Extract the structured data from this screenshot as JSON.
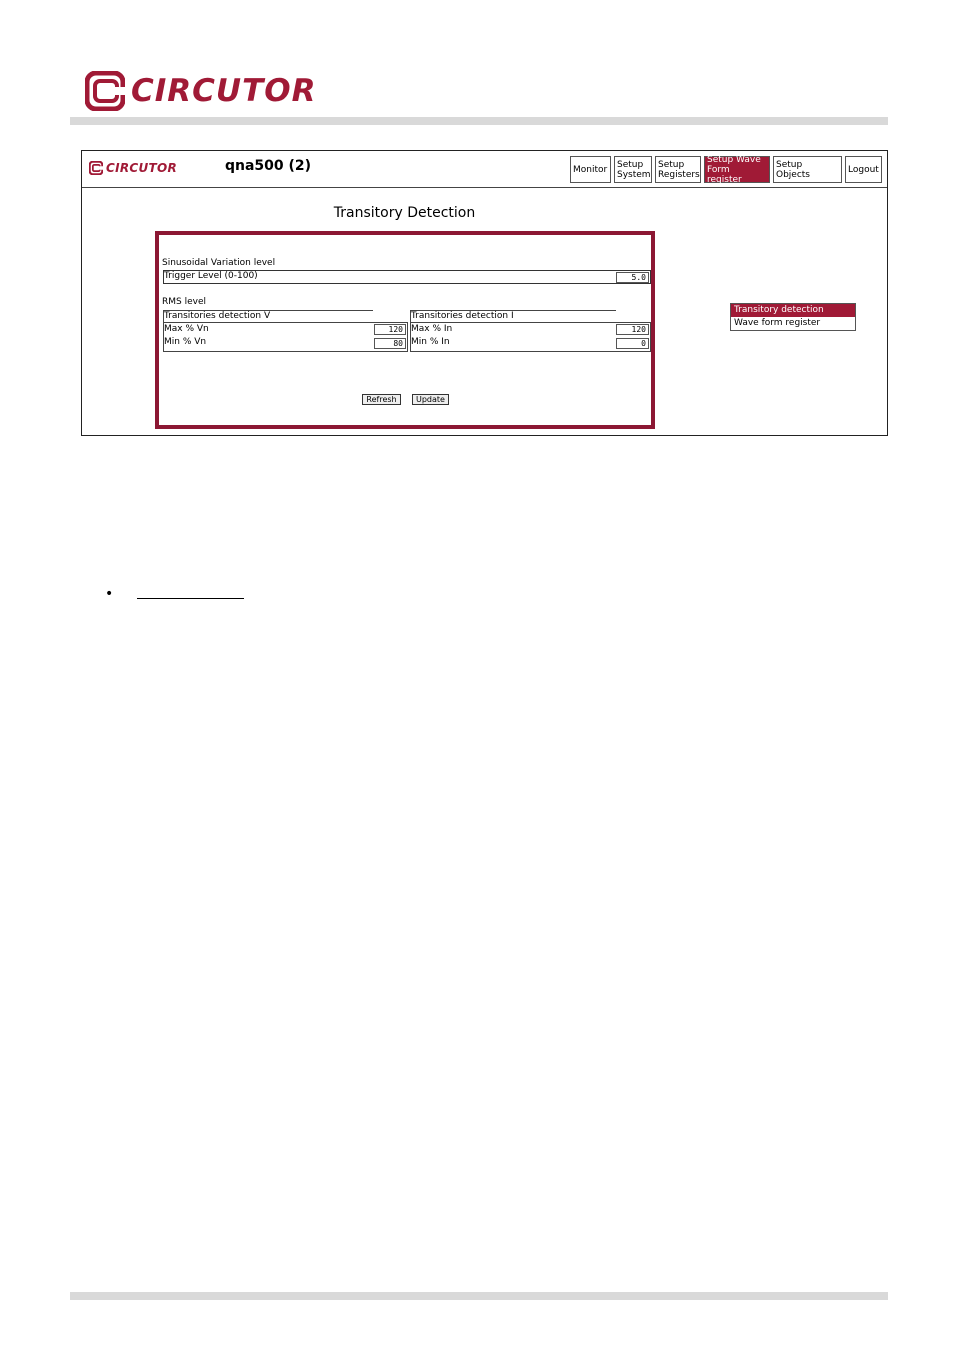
{
  "brand": {
    "name": "CIRCUTOR",
    "color": "#a01a36"
  },
  "device_title": "qna500 (2)",
  "nav": [
    {
      "label": "Monitor",
      "active": false
    },
    {
      "label": "Setup System",
      "active": false
    },
    {
      "label": "Setup Registers",
      "active": false
    },
    {
      "label": "Setup Wave Form register",
      "active": true
    },
    {
      "label": "Setup Objects",
      "active": false
    },
    {
      "label": "Logout",
      "active": false
    }
  ],
  "page_title": "Transitory Detection",
  "sinusoidal": {
    "heading": "Sinusoidal Variation level",
    "trigger_label": "Trigger Level (0-100)",
    "trigger_value": "5.0"
  },
  "rms": {
    "heading": "RMS level",
    "voltage": {
      "title": "Transitories detection V",
      "max_label": "Max % Vn",
      "max_value": "120",
      "min_label": "Min % Vn",
      "min_value": "80"
    },
    "current": {
      "title": "Transitories detection I",
      "max_label": "Max % In",
      "max_value": "120",
      "min_label": "Min % In",
      "min_value": "0"
    }
  },
  "buttons": {
    "refresh": "Refresh",
    "update": "Update"
  },
  "side_menu": [
    {
      "label": "Transitory detection",
      "selected": true
    },
    {
      "label": "Wave form register",
      "selected": false
    }
  ],
  "bullet": "•"
}
